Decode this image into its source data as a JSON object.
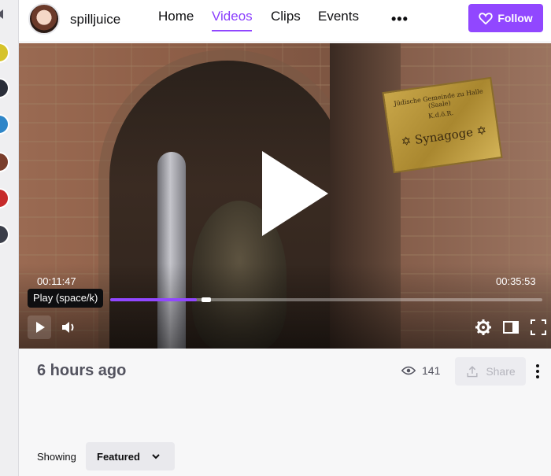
{
  "channel": {
    "name": "spilljuice"
  },
  "nav": {
    "links": [
      {
        "label": "Home",
        "active": false
      },
      {
        "label": "Videos",
        "active": true
      },
      {
        "label": "Clips",
        "active": false
      },
      {
        "label": "Events",
        "active": false
      }
    ],
    "more_icon": "more-horizontal-icon"
  },
  "follow": {
    "label": "Follow",
    "icon": "heart-icon"
  },
  "sidebar": {
    "avatars": [
      {
        "color": "#d6c32a"
      },
      {
        "color": "#2b2f3a"
      },
      {
        "color": "#2f86c8"
      },
      {
        "color": "#7a3e2c"
      },
      {
        "color": "#c72b2b"
      },
      {
        "color": "#3b3e4a"
      }
    ],
    "collapse_icon": "collapse-left-icon"
  },
  "player": {
    "plaque_line1": "Jüdische Gemeinde zu Halle (Saale)",
    "plaque_line2": "K.d.ö.R.",
    "plaque_line3": "✡ Synagoge ✡",
    "current_time": "00:11:47",
    "duration": "00:35:53",
    "tooltip": "Play (space/k)",
    "progress": {
      "played_fraction": 0.2,
      "buffered_fraction": 0.233
    },
    "controls": {
      "play_icon": "play-icon",
      "volume_icon": "volume-icon",
      "settings_icon": "gear-icon",
      "theater_icon": "theater-mode-icon",
      "fullscreen_icon": "fullscreen-icon"
    },
    "colors": {
      "accent": "#9147ff"
    }
  },
  "info": {
    "posted": "6 hours ago",
    "views": "141",
    "share_label": "Share"
  },
  "filter": {
    "label": "Showing",
    "selected": "Featured"
  }
}
